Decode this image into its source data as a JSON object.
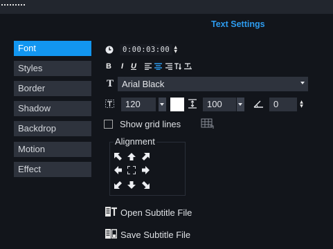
{
  "panel": {
    "heading": "Text Settings"
  },
  "sidebar": {
    "items": [
      {
        "label": "Font",
        "active": true
      },
      {
        "label": "Styles",
        "active": false
      },
      {
        "label": "Border",
        "active": false
      },
      {
        "label": "Shadow",
        "active": false
      },
      {
        "label": "Backdrop",
        "active": false
      },
      {
        "label": "Motion",
        "active": false
      },
      {
        "label": "Effect",
        "active": false
      }
    ]
  },
  "duration": {
    "value": "0:00:03:00"
  },
  "format_bar": {
    "bold": "B",
    "italic": "I",
    "underline": "U"
  },
  "font": {
    "family": "Arial Black"
  },
  "size": {
    "value": "120"
  },
  "text_color": "#ffffff",
  "line_spacing": {
    "value": "100"
  },
  "angle": {
    "value": "0"
  },
  "grid": {
    "label": "Show grid lines",
    "checked": false
  },
  "alignment": {
    "label": "Alignment"
  },
  "actions": {
    "open_subtitle": "Open Subtitle File",
    "save_subtitle": "Save Subtitle File"
  },
  "colors": {
    "accent": "#1296f0",
    "heading": "#2d9cf0",
    "panel": "#12151b",
    "control": "#2e333d"
  }
}
